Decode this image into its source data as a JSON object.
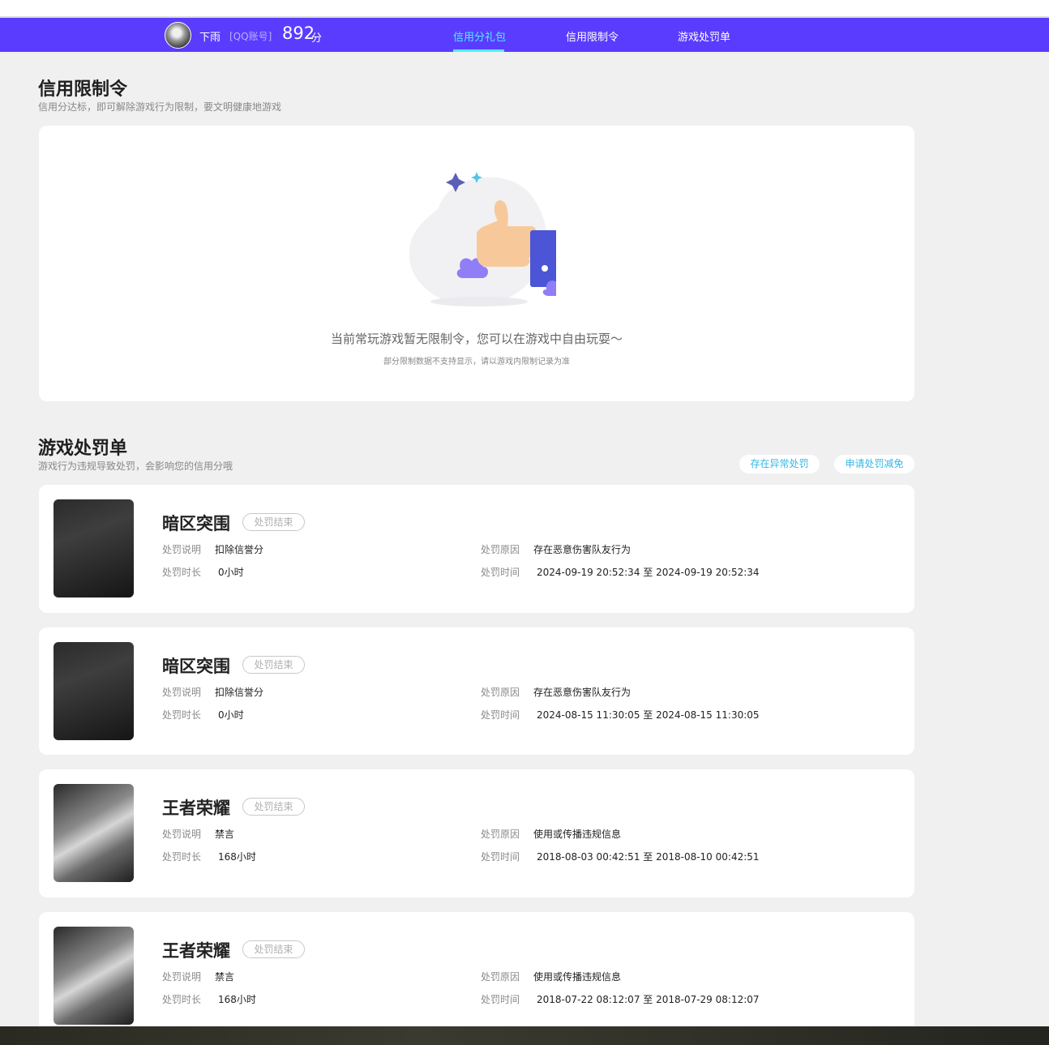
{
  "header": {
    "username": "下雨",
    "account_type": "[QQ账号]",
    "score": "892",
    "score_unit": "分",
    "tabs": [
      {
        "label": "信用分礼包",
        "active": true
      },
      {
        "label": "信用限制令",
        "active": false
      },
      {
        "label": "游戏处罚单",
        "active": false
      }
    ],
    "accent_color": "#5a3cff",
    "active_tab_color": "#4ff0ff"
  },
  "restriction": {
    "title": "信用限制令",
    "subtitle": "信用分达标，即可解除游戏行为限制，要文明健康地游戏",
    "empty_message": "当前常玩游戏暂无限制令，您可以在游戏中自由玩耍～",
    "empty_note": "部分限制数据不支持显示，请以游戏内限制记录为准",
    "illustration_icon": "thumbs-up-icon"
  },
  "penalty": {
    "title": "游戏处罚单",
    "subtitle": "游戏行为违规导致处罚，会影响您的信用分哦",
    "actions": [
      "存在异常处罚",
      "申请处罚减免"
    ],
    "labels": {
      "description": "处罚说明",
      "duration": "处罚时长",
      "reason": "处罚原因",
      "time": "处罚时间"
    },
    "records": [
      {
        "game": "暗区突围",
        "status": "处罚结束",
        "description": "扣除信誉分",
        "duration": "0小时",
        "reason": "存在恶意伤害队友行为",
        "time": "2024-09-19 20:52:34 至 2024-09-19 20:52:34"
      },
      {
        "game": "暗区突围",
        "status": "处罚结束",
        "description": "扣除信誉分",
        "duration": "0小时",
        "reason": "存在恶意伤害队友行为",
        "time": "2024-08-15 11:30:05 至 2024-08-15 11:30:05"
      },
      {
        "game": "王者荣耀",
        "status": "处罚结束",
        "description": "禁言",
        "duration": "168小时",
        "reason": "使用或传播违规信息",
        "time": "2018-08-03 00:42:51 至 2018-08-10 00:42:51"
      },
      {
        "game": "王者荣耀",
        "status": "处罚结束",
        "description": "禁言",
        "duration": "168小时",
        "reason": "使用或传播违规信息",
        "time": "2018-07-22 08:12:07 至 2018-07-29 08:12:07"
      }
    ]
  }
}
